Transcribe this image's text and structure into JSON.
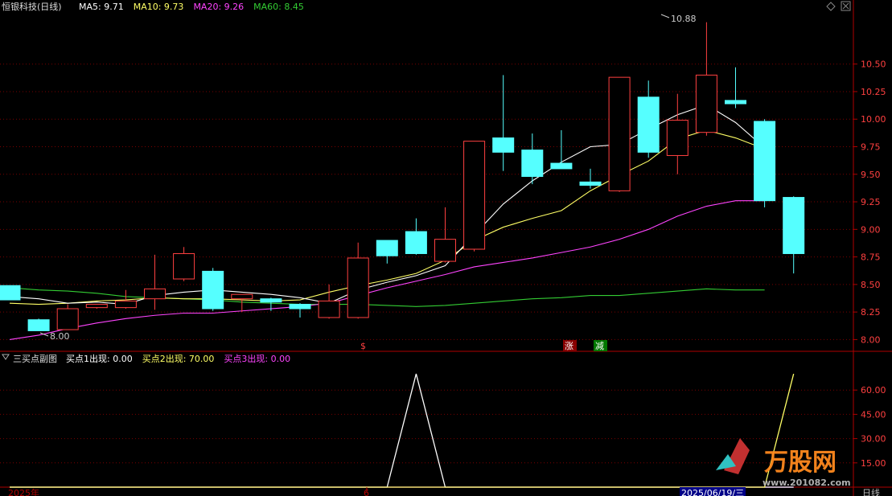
{
  "title": "恒银科技(日线)",
  "ma": [
    {
      "label": "MA5: 9.71",
      "color": "#ffffff"
    },
    {
      "label": "MA10: 9.73",
      "color": "#ffff66"
    },
    {
      "label": "MA20: 9.26",
      "color": "#ff44ff"
    },
    {
      "label": "MA60: 8.45",
      "color": "#33cc33"
    }
  ],
  "sub": {
    "title": "三买点副图",
    "items": [
      {
        "label": "买点1出现: 0.00",
        "color": "#ffffff"
      },
      {
        "label": "买点2出现: 70.00",
        "color": "#ffff66"
      },
      {
        "label": "买点3出现: 0.00",
        "color": "#ff44ff"
      }
    ],
    "y_ticks": [
      "60.00",
      "45.00",
      "30.00",
      "15.00"
    ]
  },
  "price_ticks": [
    "10.50",
    "10.25",
    "10.00",
    "9.75",
    "9.50",
    "9.25",
    "9.00",
    "8.75",
    "8.50",
    "8.25",
    "8.00"
  ],
  "high_label": "10.88",
  "low_label": "8.00",
  "markers": {
    "s": "$",
    "zhang": "涨",
    "jian": "减"
  },
  "bottom": {
    "left": "2025年",
    "mid": "6",
    "right": "2025/06/19/三",
    "mode": "日线"
  },
  "watermark": {
    "brand": "万股网",
    "url": "www.201082.com"
  },
  "colors": {
    "up": "#ff4040",
    "down": "#55ffff",
    "grid": "#7a0000",
    "axis": "#b00000"
  },
  "chart_data": {
    "type": "candlestick",
    "ohlc": [
      [
        8.49,
        8.48,
        8.38,
        8.36
      ],
      [
        8.18,
        8.19,
        8.13,
        8.08
      ],
      [
        8.09,
        8.32,
        8.12,
        8.28
      ],
      [
        8.29,
        8.32,
        8.28,
        8.32
      ],
      [
        8.29,
        8.45,
        8.28,
        8.35
      ],
      [
        8.37,
        8.77,
        8.27,
        8.46
      ],
      [
        8.55,
        8.84,
        8.53,
        8.78
      ],
      [
        8.62,
        8.65,
        8.26,
        8.28
      ],
      [
        8.37,
        8.41,
        8.25,
        8.41
      ],
      [
        8.37,
        8.38,
        8.26,
        8.34
      ],
      [
        8.32,
        8.33,
        8.2,
        8.28
      ],
      [
        8.2,
        8.5,
        8.19,
        8.35
      ],
      [
        8.2,
        8.88,
        8.19,
        8.74
      ],
      [
        8.9,
        8.9,
        8.69,
        8.76
      ],
      [
        8.98,
        9.1,
        8.77,
        8.78
      ],
      [
        8.71,
        9.2,
        8.7,
        8.91
      ],
      [
        8.82,
        9.26,
        8.8,
        9.8
      ],
      [
        9.83,
        10.4,
        9.53,
        9.7
      ],
      [
        9.72,
        9.87,
        9.41,
        9.48
      ],
      [
        9.6,
        9.9,
        9.55,
        9.55
      ],
      [
        9.43,
        9.55,
        9.37,
        9.4
      ],
      [
        9.35,
        10.38,
        9.34,
        10.38
      ],
      [
        10.2,
        10.35,
        9.65,
        9.7
      ],
      [
        9.67,
        10.23,
        9.5,
        9.99
      ],
      [
        9.88,
        10.88,
        9.85,
        10.4
      ],
      [
        10.17,
        10.47,
        10.1,
        10.14
      ],
      [
        9.98,
        10.0,
        9.2,
        9.26
      ],
      [
        9.29,
        9.3,
        8.6,
        8.78
      ]
    ],
    "ma5": [
      8.39,
      8.37,
      8.33,
      8.34,
      8.32,
      8.4,
      8.43,
      8.45,
      8.43,
      8.41,
      8.38,
      8.33,
      8.45,
      8.52,
      8.58,
      8.67,
      8.95,
      9.23,
      9.44,
      9.61,
      9.75,
      9.77,
      9.91,
      10.04,
      10.13,
      9.97,
      9.74
    ],
    "ma10": [
      8.33,
      8.32,
      8.33,
      8.35,
      8.36,
      8.38,
      8.37,
      8.37,
      8.36,
      8.35,
      8.36,
      8.43,
      8.49,
      8.54,
      8.6,
      8.72,
      8.9,
      9.02,
      9.1,
      9.17,
      9.35,
      9.49,
      9.62,
      9.82,
      9.9,
      9.83,
      9.73
    ],
    "ma20": [
      8.0,
      8.04,
      8.1,
      8.15,
      8.19,
      8.22,
      8.24,
      8.24,
      8.26,
      8.28,
      8.3,
      8.33,
      8.4,
      8.47,
      8.53,
      8.59,
      8.66,
      8.7,
      8.74,
      8.79,
      8.84,
      8.91,
      9.0,
      9.12,
      9.21,
      9.26,
      9.26
    ],
    "ma60": [
      8.47,
      8.45,
      8.44,
      8.42,
      8.39,
      8.38,
      8.37,
      8.36,
      8.34,
      8.33,
      8.32,
      8.32,
      8.32,
      8.31,
      8.3,
      8.31,
      8.33,
      8.35,
      8.37,
      8.38,
      8.4,
      8.4,
      8.42,
      8.44,
      8.46,
      8.45,
      8.45
    ],
    "buy1": [
      0,
      0,
      0,
      0,
      0,
      0,
      0,
      0,
      0,
      0,
      0,
      0,
      0,
      0,
      70,
      0,
      0,
      0,
      0,
      0,
      0,
      0,
      0,
      0,
      0,
      0,
      0,
      0
    ],
    "buy2": [
      0,
      0,
      0,
      0,
      0,
      0,
      0,
      0,
      0,
      0,
      0,
      0,
      0,
      0,
      0,
      0,
      0,
      0,
      0,
      0,
      0,
      0,
      0,
      0,
      0,
      0,
      0,
      70
    ],
    "buy3": [
      0,
      0,
      0,
      0,
      0,
      0,
      0,
      0,
      0,
      0,
      0,
      0,
      0,
      0,
      0,
      0,
      0,
      0,
      0,
      0,
      0,
      0,
      0,
      0,
      0,
      0,
      0,
      0
    ],
    "price_range": [
      7.93,
      10.95
    ],
    "sub_range": [
      0,
      75
    ]
  }
}
